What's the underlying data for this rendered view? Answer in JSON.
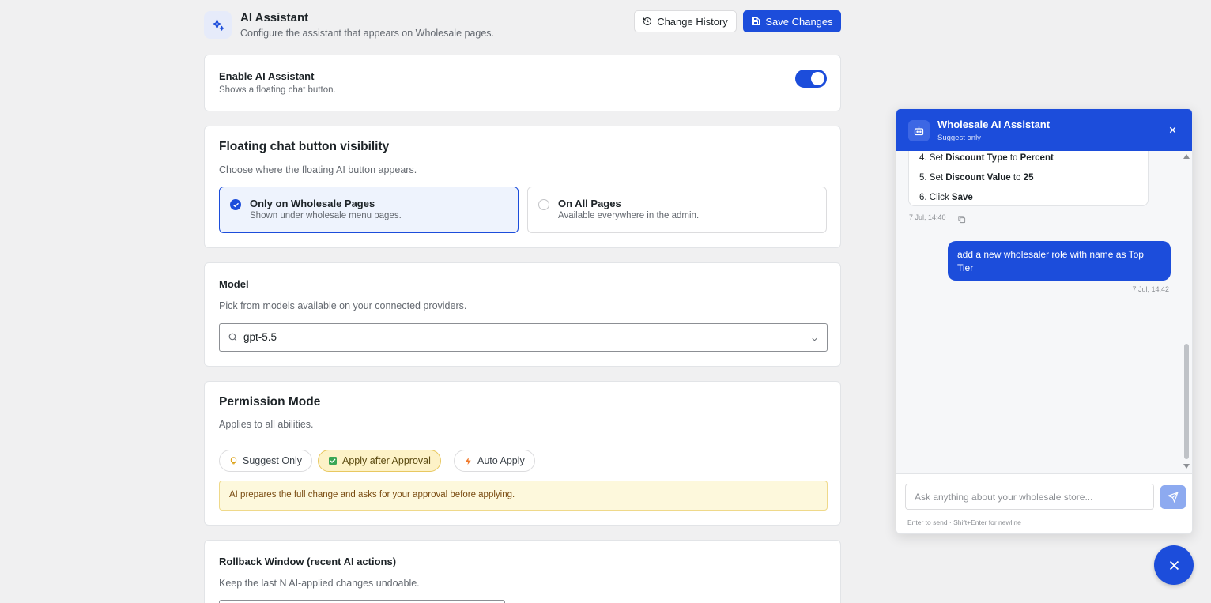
{
  "header": {
    "title": "AI Assistant",
    "subtitle": "Configure the assistant that appears on Wholesale pages.",
    "change_history_label": "Change History",
    "save_label": "Save Changes",
    "icon": "sparkle-icon"
  },
  "enable": {
    "title": "Enable AI Assistant",
    "desc": "Shows a floating chat button.",
    "enabled": true
  },
  "visibility": {
    "title": "Floating chat button visibility",
    "desc": "Choose where the floating AI button appears.",
    "options": [
      {
        "label": "Only on Wholesale Pages",
        "sub": "Shown under wholesale menu pages.",
        "selected": true
      },
      {
        "label": "On All Pages",
        "sub": "Available everywhere in the admin.",
        "selected": false
      }
    ]
  },
  "model": {
    "title": "Model",
    "desc": "Pick from models available on your connected providers.",
    "value": "gpt-5.5"
  },
  "permission": {
    "title": "Permission Mode",
    "desc": "Applies to all abilities.",
    "modes": [
      {
        "label": "Suggest Only",
        "icon": "bulb-icon",
        "selected": false
      },
      {
        "label": "Apply after Approval",
        "icon": "checkbox-icon",
        "selected": true
      },
      {
        "label": "Auto Apply",
        "icon": "bolt-icon",
        "selected": false
      }
    ],
    "note": "AI prepares the full change and asks for your approval before applying."
  },
  "rollback": {
    "title": "Rollback Window (recent AI actions)",
    "desc": "Keep the last N AI-applied changes undoable."
  },
  "chat": {
    "title": "Wholesale AI Assistant",
    "subtitle": "Suggest only",
    "steps": [
      {
        "num": "4. Set ",
        "bold": "Discount Type",
        "rest": " to ",
        "bold2": "Percent"
      },
      {
        "num": "5. Set ",
        "bold": "Discount Value",
        "rest": " to ",
        "bold2": "25"
      },
      {
        "num": "6. Click ",
        "bold": "Save",
        "rest": "",
        "bold2": ""
      }
    ],
    "bot_time": "7 Jul, 14:40",
    "user_message": "add a new wholesaler role with name as Top Tier",
    "user_time": "7 Jul, 14:42",
    "input_placeholder": "Ask anything about your wholesale store...",
    "hint": "Enter to send · Shift+Enter for newline"
  },
  "colors": {
    "primary": "#1c4ddb",
    "approval_bg": "#fdf2c7",
    "note_bg": "#fdf8dc"
  }
}
